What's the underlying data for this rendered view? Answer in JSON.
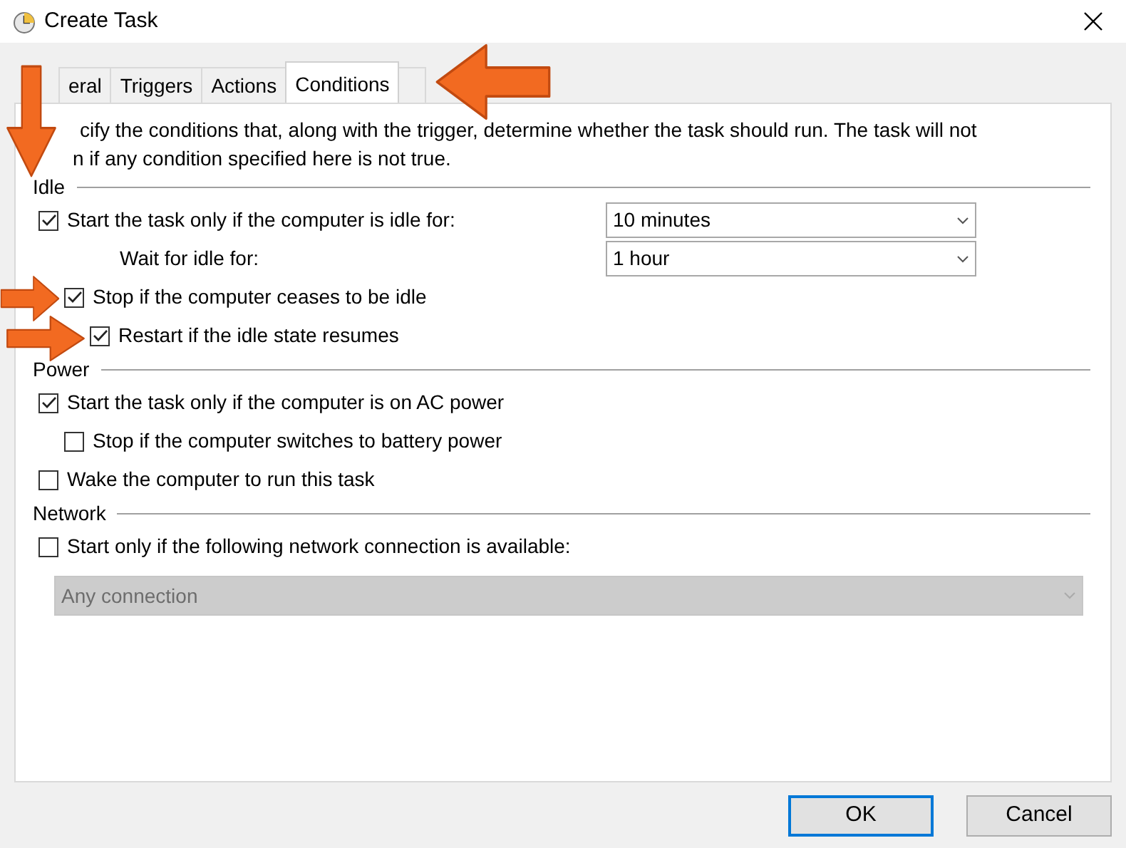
{
  "window": {
    "title": "Create Task"
  },
  "tabs": [
    {
      "label": "eral",
      "selected": false
    },
    {
      "label": "Triggers",
      "selected": false
    },
    {
      "label": "Actions",
      "selected": false
    },
    {
      "label": "Conditions",
      "selected": true
    },
    {
      "selected": false
    }
  ],
  "description": [
    "cify the conditions that, along with the trigger, determine whether the task should run.  The task will not",
    "n  if any condition specified here is not true."
  ],
  "sections": [
    {
      "title": "Idle",
      "rows": [
        {
          "kind": "checkbox",
          "label": "Start the task only if the computer is idle for:",
          "checked": true,
          "value": "10 minutes",
          "children": [
            {
              "kind": "combo",
              "label": "Wait for idle for:",
              "value": "1 hour"
            },
            {
              "kind": "checkbox",
              "label": "Stop if the computer ceases to be idle",
              "checked": true,
              "children": [
                {
                  "kind": "checkbox",
                  "label": "Restart if the idle state resumes",
                  "checked": true
                }
              ]
            }
          ]
        }
      ]
    },
    {
      "title": "Power",
      "rows": [
        {
          "kind": "checkbox",
          "label": "Start the task only if the computer is on AC power",
          "checked": true,
          "children": [
            {
              "kind": "checkbox",
              "label": "Stop if the computer switches to battery power",
              "checked": false
            }
          ]
        },
        {
          "kind": "checkbox",
          "label": "Wake the computer to run this task",
          "checked": false
        }
      ]
    },
    {
      "title": "Network",
      "rows": [
        {
          "kind": "checkbox",
          "label": "Start only if the following network connection is available:",
          "checked": false
        },
        {
          "kind": "dropdown",
          "value": "Any connection",
          "disabled": true
        }
      ]
    }
  ],
  "buttons": [
    {
      "label": "OK",
      "default": true
    },
    {
      "label": "Cancel",
      "default": false
    }
  ],
  "annotations": [
    {
      "kind": "down-arrow"
    },
    {
      "kind": "left-arrow"
    },
    {
      "kind": "right-arrow"
    },
    {
      "kind": "right-arrow"
    }
  ]
}
